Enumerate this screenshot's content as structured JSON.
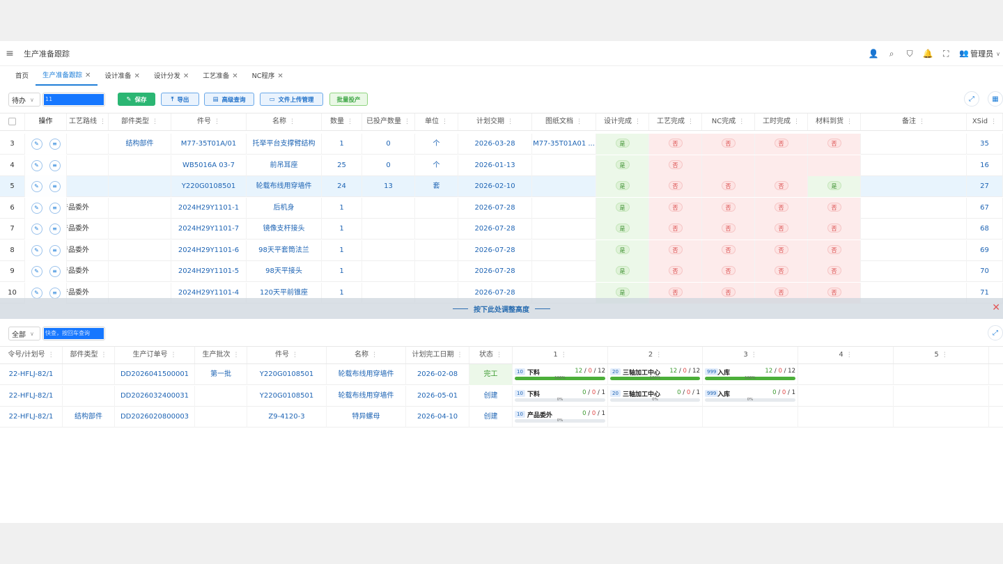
{
  "header": {
    "title": "生产准备跟踪",
    "user": "管理员"
  },
  "tabs": [
    {
      "label": "首页",
      "closable": false
    },
    {
      "label": "生产准备跟踪",
      "closable": true,
      "active": true
    },
    {
      "label": "设计准备",
      "closable": true
    },
    {
      "label": "设计分发",
      "closable": true
    },
    {
      "label": "工艺准备",
      "closable": true
    },
    {
      "label": "NC程序",
      "closable": true
    }
  ],
  "toolbar": {
    "status_select": "待办",
    "search_value": "11",
    "save_label": "保存",
    "export_label": "导出",
    "advanced_label": "高级查询",
    "upload_label": "文件上传管理",
    "batch_label": "批量投产"
  },
  "top_table": {
    "columns": [
      "操作",
      "工艺路线",
      "部件类型",
      "件号",
      "名称",
      "数量",
      "已投产数量",
      "单位",
      "计划交期",
      "图纸文档",
      "设计完成",
      "工艺完成",
      "NC完成",
      "工时完成",
      "材料到货",
      "备注",
      "XSid"
    ],
    "rows": [
      {
        "idx": "3",
        "route": "",
        "type": "结构部件",
        "part": "M77-35T01A/01",
        "name": "托举平台支撑臂结构",
        "qty": "1",
        "done_qty": "0",
        "unit": "个",
        "date": "2026-03-28",
        "doc": "M77-35T01A01 ...",
        "design": "是",
        "process": "否",
        "nc": "否",
        "hours": "否",
        "material": "否",
        "remark": "",
        "xsid": "35"
      },
      {
        "idx": "4",
        "route": "",
        "type": "",
        "part": "WB5016A 03-7",
        "name": "前吊耳座",
        "qty": "25",
        "done_qty": "0",
        "unit": "个",
        "date": "2026-01-13",
        "doc": "",
        "design": "是",
        "process": "否",
        "nc": "",
        "hours": "",
        "material": "",
        "remark": "",
        "xsid": "16"
      },
      {
        "idx": "5",
        "route": "",
        "type": "",
        "part": "Y220G0108501",
        "name": "轮载布线用穿墙件",
        "qty": "24",
        "done_qty": "13",
        "unit": "套",
        "date": "2026-02-10",
        "doc": "",
        "design": "是",
        "process": "否",
        "nc": "否",
        "hours": "否",
        "material": "是",
        "remark": "",
        "xsid": "27"
      },
      {
        "idx": "6",
        "route": "产品委外",
        "type": "",
        "part": "2024H29Y1101-1",
        "name": "后机身",
        "qty": "1",
        "done_qty": "",
        "unit": "",
        "date": "2026-07-28",
        "doc": "",
        "design": "是",
        "process": "否",
        "nc": "否",
        "hours": "否",
        "material": "否",
        "remark": "",
        "xsid": "67"
      },
      {
        "idx": "7",
        "route": "产品委外",
        "type": "",
        "part": "2024H29Y1101-7",
        "name": "镜像支杆接头",
        "qty": "1",
        "done_qty": "",
        "unit": "",
        "date": "2026-07-28",
        "doc": "",
        "design": "是",
        "process": "否",
        "nc": "否",
        "hours": "否",
        "material": "否",
        "remark": "",
        "xsid": "68"
      },
      {
        "idx": "8",
        "route": "产品委外",
        "type": "",
        "part": "2024H29Y1101-6",
        "name": "98天平套筒法兰",
        "qty": "1",
        "done_qty": "",
        "unit": "",
        "date": "2026-07-28",
        "doc": "",
        "design": "是",
        "process": "否",
        "nc": "否",
        "hours": "否",
        "material": "否",
        "remark": "",
        "xsid": "69"
      },
      {
        "idx": "9",
        "route": "产品委外",
        "type": "",
        "part": "2024H29Y1101-5",
        "name": "98天平接头",
        "qty": "1",
        "done_qty": "",
        "unit": "",
        "date": "2026-07-28",
        "doc": "",
        "design": "是",
        "process": "否",
        "nc": "否",
        "hours": "否",
        "material": "否",
        "remark": "",
        "xsid": "70"
      },
      {
        "idx": "10",
        "route": "产品委外",
        "type": "",
        "part": "2024H29Y1101-4",
        "name": "120天平前锥座",
        "qty": "1",
        "done_qty": "",
        "unit": "",
        "date": "2026-07-28",
        "doc": "",
        "design": "是",
        "process": "否",
        "nc": "否",
        "hours": "否",
        "material": "否",
        "remark": "",
        "xsid": "71"
      }
    ]
  },
  "splitter": {
    "label": "按下此处调整高度"
  },
  "bottom_toolbar": {
    "filter_select": "全部",
    "search_placeholder": "快查，按回车查询"
  },
  "bottom_table": {
    "columns": [
      "令号/计划号",
      "部件类型",
      "生产订单号",
      "生产批次",
      "件号",
      "名称",
      "计划完工日期",
      "状态",
      "1",
      "2",
      "3",
      "4",
      "5"
    ],
    "rows": [
      {
        "plan": "22-HFLJ-82/1",
        "type": "",
        "order": "DD2026041500001",
        "batch": "第一批",
        "part": "Y220G0108501",
        "name": "轮载布线用穿墙件",
        "date": "2026-02-08",
        "status": "完工",
        "procs": [
          {
            "seq": "10",
            "name": "下料",
            "done": "12",
            "bad": "0",
            "total": "12",
            "pct": "100%",
            "progress": 1.0
          },
          {
            "seq": "20",
            "name": "三轴加工中心",
            "done": "12",
            "bad": "0",
            "total": "12",
            "pct": "100%",
            "progress": 1.0
          },
          {
            "seq": "999",
            "name": "入库",
            "done": "12",
            "bad": "0",
            "total": "12",
            "pct": "100%",
            "progress": 1.0
          }
        ]
      },
      {
        "plan": "22-HFLJ-82/1",
        "type": "",
        "order": "DD2026032400031",
        "batch": "",
        "part": "Y220G0108501",
        "name": "轮载布线用穿墙件",
        "date": "2026-05-01",
        "status": "创建",
        "procs": [
          {
            "seq": "10",
            "name": "下料",
            "done": "0",
            "bad": "0",
            "total": "1",
            "pct": "0%",
            "progress": 0.0
          },
          {
            "seq": "20",
            "name": "三轴加工中心",
            "done": "0",
            "bad": "0",
            "total": "1",
            "pct": "0%",
            "progress": 0.0
          },
          {
            "seq": "999",
            "name": "入库",
            "done": "0",
            "bad": "0",
            "total": "1",
            "pct": "0%",
            "progress": 0.0
          }
        ]
      },
      {
        "plan": "22-HFLJ-82/1",
        "type": "结构部件",
        "order": "DD2026020800003",
        "batch": "",
        "part": "Z9-4120-3",
        "name": "特异螺母",
        "date": "2026-04-10",
        "status": "创建",
        "procs": [
          {
            "seq": "10",
            "name": "产品委外",
            "done": "0",
            "bad": "0",
            "total": "1",
            "pct": "0%",
            "progress": 0.0
          }
        ]
      }
    ]
  }
}
